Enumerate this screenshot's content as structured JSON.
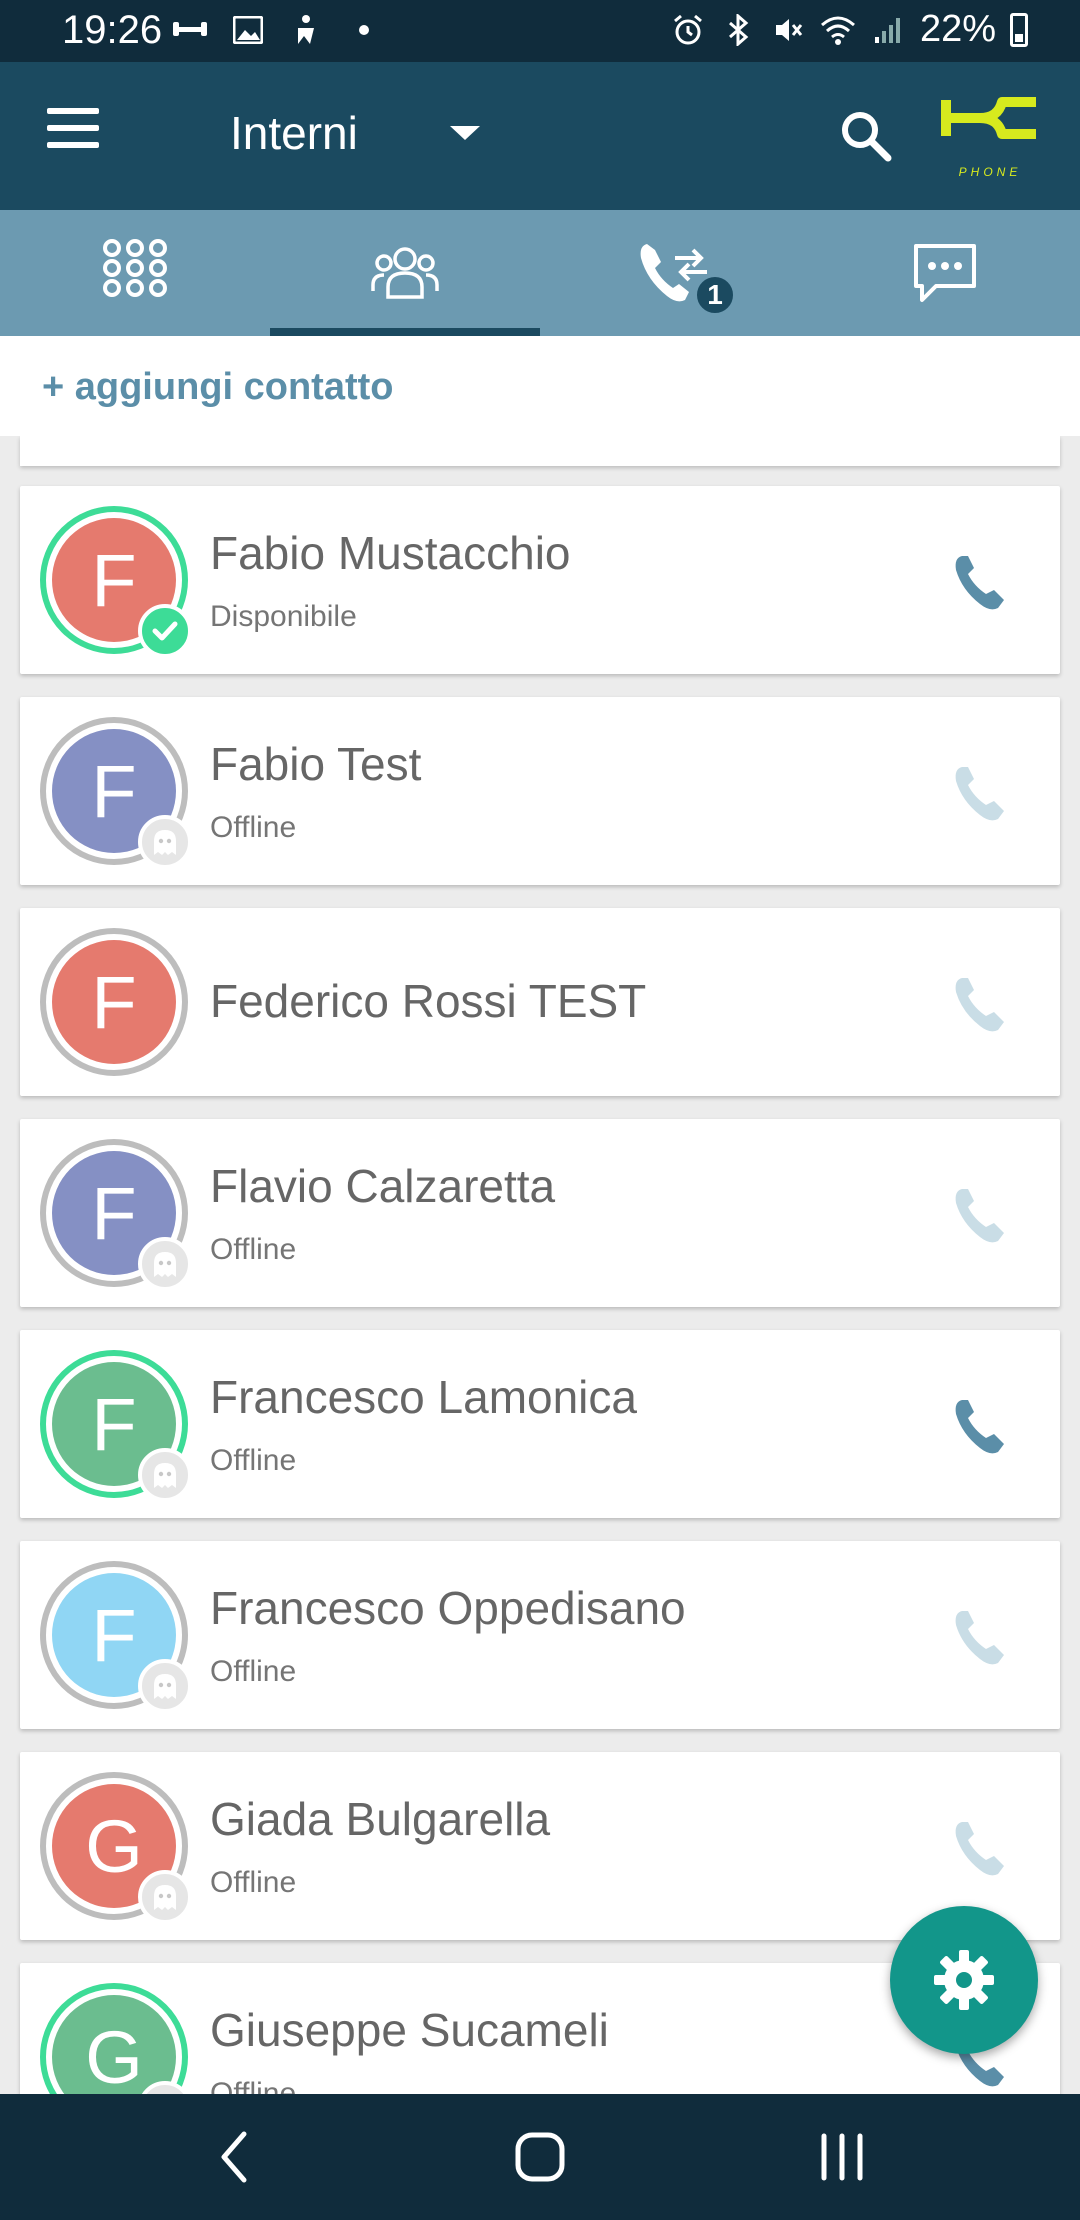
{
  "status_bar": {
    "time": "19:26",
    "battery": "22%",
    "left_icons": [
      "tty-icon",
      "image-icon",
      "accessibility-icon",
      "dot-icon"
    ],
    "right_icons": [
      "alarm-icon",
      "bluetooth-icon",
      "mute-icon",
      "wifi-icon",
      "signal-icon",
      "battery-icon"
    ]
  },
  "app_bar": {
    "title": "Interni",
    "logo_text": "PHONE",
    "accent_color": "#d7ea1e"
  },
  "tabs": [
    {
      "name": "dialpad",
      "icon": "dialpad-icon",
      "active": false
    },
    {
      "name": "contacts",
      "icon": "contacts-icon",
      "active": true
    },
    {
      "name": "call-transfer",
      "icon": "call-transfer-icon",
      "active": false,
      "badge": "1"
    },
    {
      "name": "chat",
      "icon": "chat-icon",
      "active": false
    }
  ],
  "add_contact_label": "+ aggiungi contatto",
  "contacts": [
    {
      "initial": "F",
      "name": "Fabio Mustacchio",
      "status": "Disponibile",
      "avatar_color": "#e57a6e",
      "ring": "online",
      "presence": "available",
      "call_enabled": true
    },
    {
      "initial": "F",
      "name": "Fabio Test",
      "status": "Offline",
      "avatar_color": "#8590c4",
      "ring": "offline",
      "presence": "ghost",
      "call_enabled": false
    },
    {
      "initial": "F",
      "name": "Federico Rossi TEST",
      "status": "",
      "avatar_color": "#e57a6e",
      "ring": "offline",
      "presence": "none",
      "call_enabled": false
    },
    {
      "initial": "F",
      "name": "Flavio Calzaretta",
      "status": "Offline",
      "avatar_color": "#8590c4",
      "ring": "offline",
      "presence": "ghost",
      "call_enabled": false
    },
    {
      "initial": "F",
      "name": "Francesco Lamonica",
      "status": "Offline",
      "avatar_color": "#6bbd8f",
      "ring": "online",
      "presence": "ghost",
      "call_enabled": true
    },
    {
      "initial": "F",
      "name": "Francesco Oppedisano",
      "status": "Offline",
      "avatar_color": "#90d6f4",
      "ring": "offline",
      "presence": "ghost",
      "call_enabled": false
    },
    {
      "initial": "G",
      "name": "Giada Bulgarella",
      "status": "Offline",
      "avatar_color": "#e57a6e",
      "ring": "offline",
      "presence": "ghost",
      "call_enabled": false
    },
    {
      "initial": "G",
      "name": "Giuseppe Sucameli",
      "status": "Offline",
      "avatar_color": "#6bbd8f",
      "ring": "online",
      "presence": "ghost",
      "call_enabled": true
    }
  ],
  "fab_icon": "settings-gear-icon",
  "nav_bar": [
    "back-icon",
    "home-icon",
    "recents-icon"
  ],
  "colors": {
    "status_bar": "#102c3c",
    "app_bar": "#1b4a60",
    "tab_bar": "#6c9ab1",
    "call_enabled": "#5b8ea8",
    "call_disabled": "#c9dde6",
    "fab": "#12968a",
    "online_ring": "#3ddc97"
  }
}
